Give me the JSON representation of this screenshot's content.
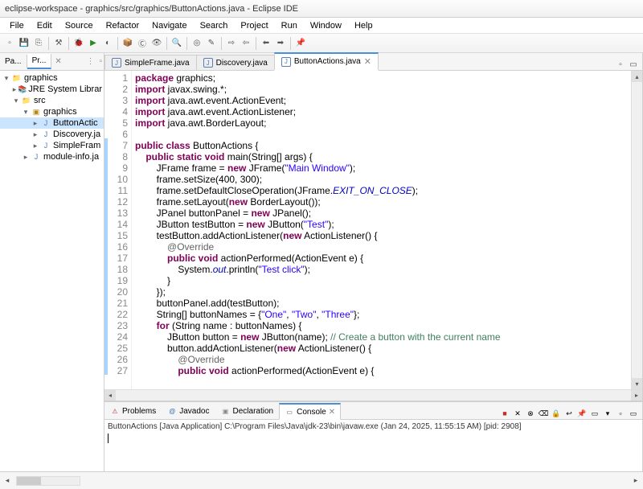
{
  "window": {
    "title": "eclipse-workspace - graphics/src/graphics/ButtonActions.java - Eclipse IDE"
  },
  "menu": [
    "File",
    "Edit",
    "Source",
    "Refactor",
    "Navigate",
    "Search",
    "Project",
    "Run",
    "Window",
    "Help"
  ],
  "sidebar": {
    "tabs": [
      {
        "label": "Pa..."
      },
      {
        "label": "Pr..."
      }
    ],
    "tree": {
      "project": "graphics",
      "jre": "JRE System Librar",
      "src": "src",
      "pkg": "graphics",
      "files": [
        "ButtonActic",
        "Discovery.ja",
        "SimpleFram"
      ],
      "module": "module-info.ja"
    }
  },
  "editorTabs": [
    {
      "label": "SimpleFrame.java"
    },
    {
      "label": "Discovery.java"
    },
    {
      "label": "ButtonActions.java"
    }
  ],
  "code": {
    "l1_a": "package",
    "l1_b": " graphics;",
    "l2_a": "import",
    "l2_b": " javax.swing.*;",
    "l3_a": "import",
    "l3_b": " java.awt.event.ActionEvent;",
    "l4_a": "import",
    "l4_b": " java.awt.event.ActionListener;",
    "l5_a": "import",
    "l5_b": " java.awt.BorderLayout;",
    "l6": "",
    "l7_a": "public class",
    "l7_b": " ButtonActions {",
    "l8_a": "    public static void",
    "l8_b": " main(String[] args) {",
    "l9_a": "        JFrame frame = ",
    "l9_b": "new",
    "l9_c": " JFrame(",
    "l9_d": "\"Main Window\"",
    "l9_e": ");",
    "l10": "        frame.setSize(400, 300);",
    "l11_a": "        frame.setDefaultCloseOperation(JFrame.",
    "l11_b": "EXIT_ON_CLOSE",
    "l11_c": ");",
    "l12_a": "        frame.setLayout(",
    "l12_b": "new",
    "l12_c": " BorderLayout());",
    "l13_a": "        JPanel buttonPanel = ",
    "l13_b": "new",
    "l13_c": " JPanel();",
    "l14_a": "        JButton testButton = ",
    "l14_b": "new",
    "l14_c": " JButton(",
    "l14_d": "\"Test\"",
    "l14_e": ");",
    "l15_a": "        testButton.addActionListener(",
    "l15_b": "new",
    "l15_c": " ActionListener() {",
    "l16_a": "            ",
    "l16_b": "@Override",
    "l17_a": "            public void",
    "l17_b": " actionPerformed(ActionEvent e) {",
    "l18_a": "                System.",
    "l18_b": "out",
    "l18_c": ".println(",
    "l18_d": "\"Test click\"",
    "l18_e": ");",
    "l19": "            }",
    "l20": "        });",
    "l21": "        buttonPanel.add(testButton);",
    "l22_a": "        String[] buttonNames = {",
    "l22_b": "\"One\"",
    "l22_c": ", ",
    "l22_d": "\"Two\"",
    "l22_e": ", ",
    "l22_f": "\"Three\"",
    "l22_g": "};",
    "l23_a": "        for",
    "l23_b": " (String name : buttonNames) {",
    "l24_a": "            JButton button = ",
    "l24_b": "new",
    "l24_c": " JButton(name); ",
    "l24_d": "// Create a button with the current name",
    "l25_a": "            button.addActionListener(",
    "l25_b": "new",
    "l25_c": " ActionListener() {",
    "l26_a": "                ",
    "l26_b": "@Override",
    "l27_a": "                public void",
    "l27_b": " actionPerformed(ActionEvent e) {"
  },
  "lineNumbers": [
    "1",
    "2",
    "3",
    "4",
    "5",
    "6",
    "7",
    "8",
    "9",
    "10",
    "11",
    "12",
    "13",
    "14",
    "15",
    "16",
    "17",
    "18",
    "19",
    "20",
    "21",
    "22",
    "23",
    "24",
    "25",
    "26",
    "27"
  ],
  "bottom": {
    "tabs": [
      "Problems",
      "Javadoc",
      "Declaration",
      "Console"
    ],
    "console_header": "ButtonActions [Java Application] C:\\Program Files\\Java\\jdk-23\\bin\\javaw.exe  (Jan 24, 2025, 11:55:15 AM) [pid: 2908]"
  }
}
